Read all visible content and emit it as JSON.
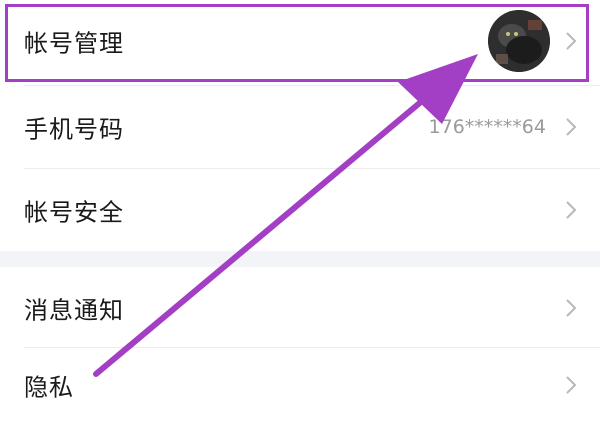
{
  "settings": {
    "items": [
      {
        "label": "帐号管理",
        "value": "",
        "has_avatar": true
      },
      {
        "label": "手机号码",
        "value": "176******64",
        "has_avatar": false
      },
      {
        "label": "帐号安全",
        "value": "",
        "has_avatar": false
      },
      {
        "label": "消息通知",
        "value": "",
        "has_avatar": false
      },
      {
        "label": "隐私",
        "value": "",
        "has_avatar": false
      }
    ]
  },
  "icons": {
    "chevron": "chevron-right-icon",
    "avatar": "user-avatar-photo"
  },
  "colors": {
    "background": "#ffffff",
    "section_gap": "#f2f4f7",
    "label_text": "#1a1a1a",
    "value_text": "#9a9a9a",
    "chevron": "#b8b8b8",
    "annotation": "#a23fc4"
  }
}
